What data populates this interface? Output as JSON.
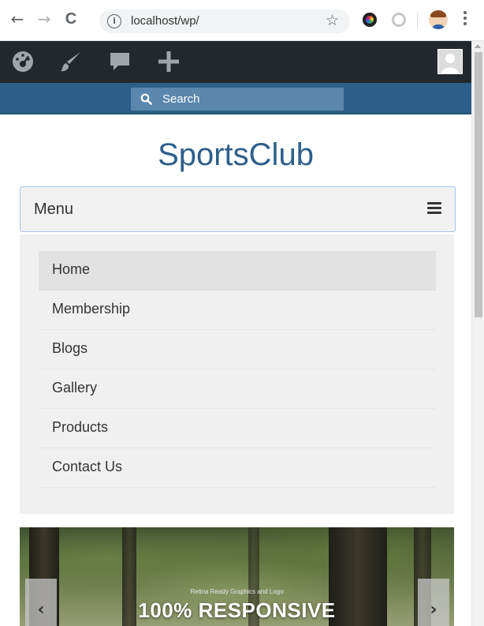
{
  "browser": {
    "back_icon": "←",
    "forward_icon": "→",
    "reload_icon": "C",
    "info_icon": "i",
    "url": "localhost/wp/",
    "star_icon": "☆"
  },
  "adminbar": {
    "icons": [
      "dashboard-icon",
      "customize-brush-icon",
      "comments-icon",
      "new-content-plus-icon",
      "user-avatar-icon"
    ],
    "bg_color": "#23282d"
  },
  "search": {
    "label": "Search",
    "bar_color": "#2d5f8a"
  },
  "site": {
    "title": "SportsClub",
    "title_color": "#2e5f8b"
  },
  "menu": {
    "label": "Menu",
    "items": [
      {
        "label": "Home",
        "active": true
      },
      {
        "label": "Membership",
        "active": false
      },
      {
        "label": "Blogs",
        "active": false
      },
      {
        "label": "Gallery",
        "active": false
      },
      {
        "label": "Products",
        "active": false
      },
      {
        "label": "Contact Us",
        "active": false
      }
    ]
  },
  "slider": {
    "subtitle": "Retina Ready Graphics and Logo",
    "title": "100% RESPONSIVE",
    "prev": "‹",
    "next": "›"
  }
}
